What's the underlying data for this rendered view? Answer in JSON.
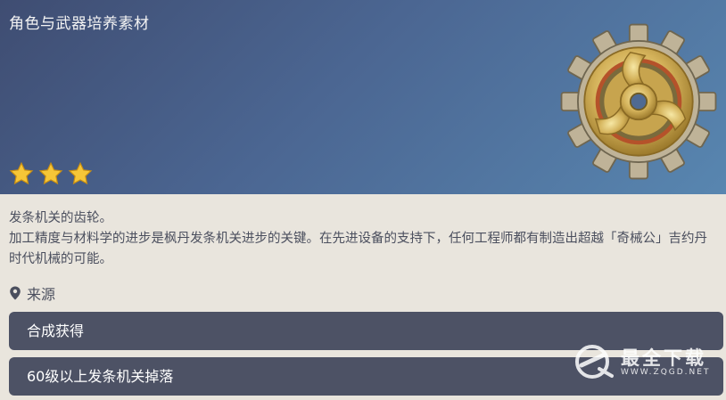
{
  "header": {
    "category": "角色与武器培养素材",
    "rarity": 3,
    "item_icon": "gear-icon"
  },
  "description": {
    "line1": "发条机关的齿轮。",
    "line2": "加工精度与材料学的进步是枫丹发条机关进步的关键。在先进设备的支持下，任何工程师都有制造出超越「奇械公」吉约丹时代机械的可能。"
  },
  "source": {
    "icon": "location-pin-icon",
    "label": "来源",
    "items": [
      {
        "label": "合成获得"
      },
      {
        "label": "60级以上发条机关掉落"
      }
    ]
  },
  "watermark": {
    "title": "最全下载",
    "subtitle": "WWW.ZQGD.NET"
  },
  "colors": {
    "header_start": "#3f4d72",
    "header_end": "#5886b0",
    "content_bg": "#e9e5dd",
    "button_bg": "#4d5265",
    "star": "#f6c637"
  }
}
